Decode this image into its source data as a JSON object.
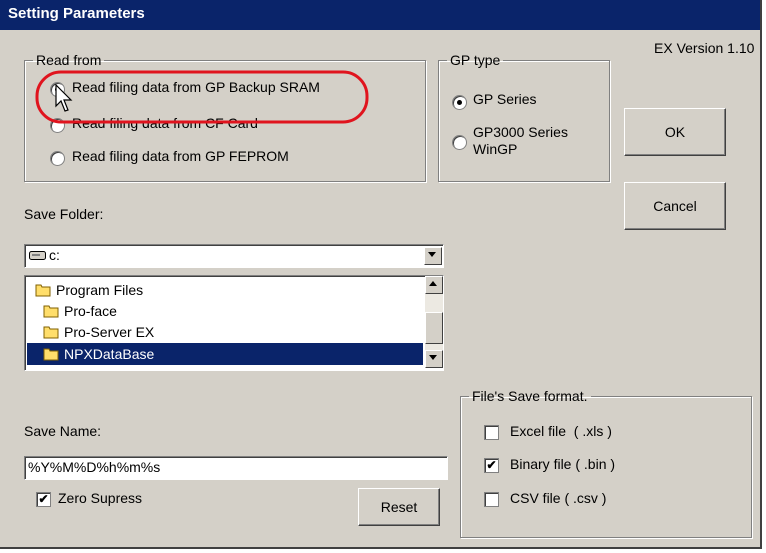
{
  "dialog": {
    "title": "Setting Parameters",
    "version": "EX Version 1.10"
  },
  "read_from": {
    "legend": "Read from",
    "options": [
      "Read filing data from GP Backup SRAM",
      "Read filing data from CF Card",
      "Read filing data from GP FEPROM"
    ],
    "selected_index": 0
  },
  "gp_type": {
    "legend": "GP type",
    "options": [
      "GP Series",
      "GP3000 Series",
      "WinGP"
    ],
    "selected": "GP Series"
  },
  "buttons": {
    "ok": "OK",
    "cancel": "Cancel",
    "reset": "Reset"
  },
  "save_folder": {
    "label": "Save Folder:",
    "drive": "c:",
    "folders": [
      "Program Files",
      "Pro-face",
      "Pro-Server EX",
      "NPXDataBase"
    ],
    "selected_folder": "NPXDataBase"
  },
  "save_name": {
    "label": "Save Name:",
    "value": "%Y%M%D%h%m%s"
  },
  "zero_supress": {
    "label": "Zero Supress",
    "checked": true
  },
  "save_format": {
    "legend": "File's Save format.",
    "options": [
      {
        "label": "Excel file  ( .xls )",
        "checked": false
      },
      {
        "label": "Binary file ( .bin )",
        "checked": true
      },
      {
        "label": "CSV file ( .csv )",
        "checked": false
      }
    ]
  },
  "annotation": {
    "highlight_color": "#e0141e"
  }
}
